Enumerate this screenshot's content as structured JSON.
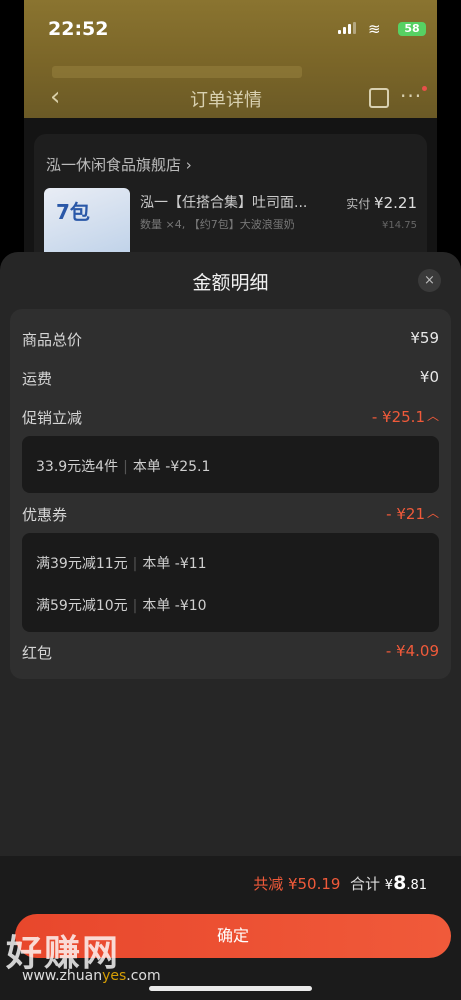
{
  "status_bar": {
    "time": "22:52",
    "battery": "58"
  },
  "nav": {
    "title": "订单详情"
  },
  "store": {
    "name": "泓一休闲食品旗舰店",
    "product_title": "泓一【任搭合集】吐司面...",
    "product_sub": "数量 ×4, 【约7包】大波浪蛋奶",
    "paid_label": "实付",
    "paid_value": "¥2.21",
    "orig_value": "¥14.75",
    "img_badge": "7包"
  },
  "sheet": {
    "title": "金额明细",
    "close_icon": "×",
    "rows": {
      "goods_total": {
        "label": "商品总价",
        "value": "¥59"
      },
      "shipping": {
        "label": "运费",
        "value": "¥0"
      },
      "promo": {
        "label": "促销立减",
        "value": "- ¥25.1"
      },
      "coupon": {
        "label": "优惠券",
        "value": "- ¥21"
      },
      "red_packet": {
        "label": "红包",
        "value": "- ¥4.09"
      }
    },
    "promo_items": [
      {
        "name": "33.9元选4件",
        "detail": "本单 -¥25.1"
      }
    ],
    "coupon_items": [
      {
        "name": "满39元减11元",
        "detail": "本单 -¥11"
      },
      {
        "name": "满59元减10元",
        "detail": "本单 -¥10"
      }
    ]
  },
  "bottom": {
    "reduce_text": "共减 ¥50.19",
    "total_label": "合计",
    "total_currency": "¥",
    "total_int": "8",
    "total_dec": ".81",
    "confirm_label": "确定"
  },
  "watermark": {
    "logo": "好赚网",
    "url_a": "www.zhuan",
    "url_b": "yes",
    "url_c": ".com"
  },
  "colors": {
    "accent": "#f05a3a",
    "sheet_bg": "#262626",
    "card_bg": "#2f2f2f"
  }
}
